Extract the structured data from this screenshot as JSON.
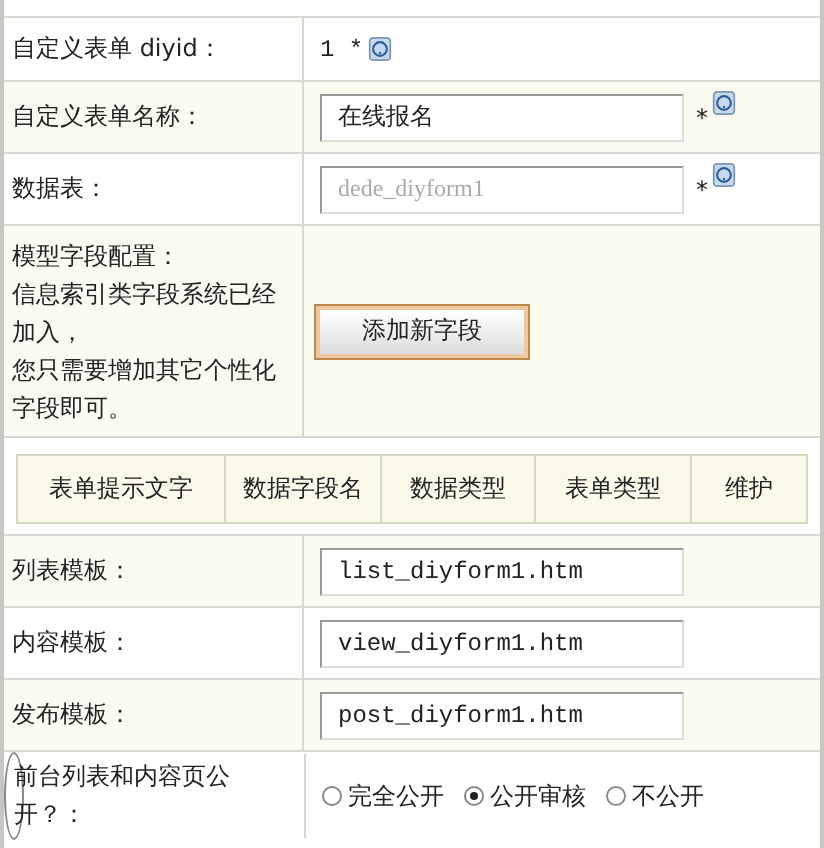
{
  "rows": [
    {
      "kind": "text",
      "label": "自定义表单 diyid：",
      "value": "1 *"
    },
    {
      "kind": "input",
      "label": "自定义表单名称：",
      "value": "在线报名",
      "required": "*",
      "disabled": false
    },
    {
      "kind": "input",
      "label": "数据表：",
      "value": "dede_diyform1",
      "required": "*",
      "disabled": true
    },
    {
      "kind": "button",
      "label": "模型字段配置：",
      "notes": [
        "信息索引类字段系统已经加入，",
        "您只需要增加其它个性化字段即可。"
      ],
      "button": "添加新字段"
    },
    {
      "kind": "header",
      "columns": [
        "表单提示文字",
        "数据字段名",
        "数据类型",
        "表单类型",
        "维护"
      ]
    },
    {
      "kind": "input",
      "label": "列表模板：",
      "value": "list_diyform1.htm",
      "disabled": false
    },
    {
      "kind": "input",
      "label": "内容模板：",
      "value": "view_diyform1.htm",
      "disabled": false
    },
    {
      "kind": "input",
      "label": "发布模板：",
      "value": "post_diyform1.htm",
      "disabled": false
    },
    {
      "kind": "radio",
      "label": "前台列表和内容页公开？：",
      "options": [
        {
          "label": "完全公开",
          "selected": false
        },
        {
          "label": "公开审核",
          "selected": true
        },
        {
          "label": "不公开",
          "selected": false
        }
      ]
    }
  ]
}
